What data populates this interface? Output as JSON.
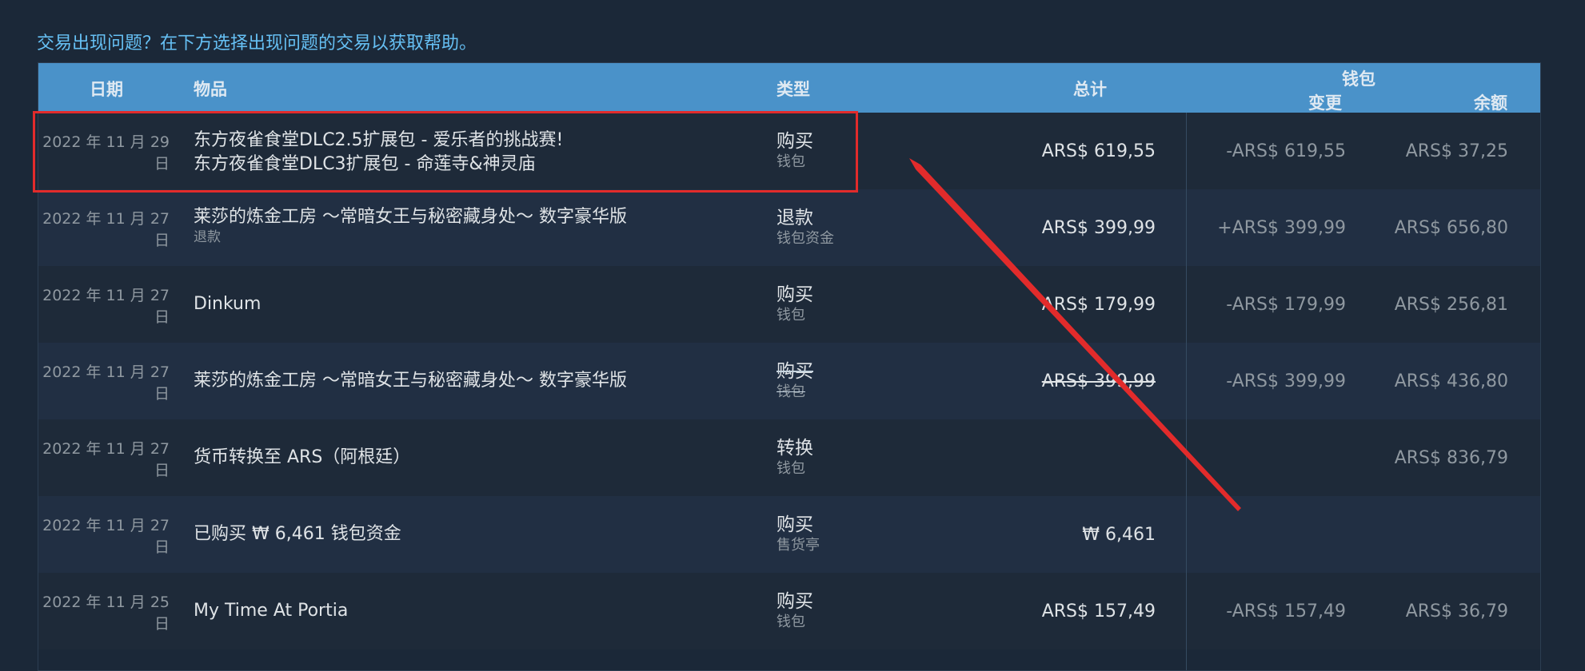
{
  "help_link": "交易出现问题？在下方选择出现问题的交易以获取帮助。",
  "headers": {
    "date": "日期",
    "items": "物品",
    "type": "类型",
    "total": "总计",
    "wallet": "钱包",
    "change": "变更",
    "balance": "余额"
  },
  "rows": [
    {
      "date_line1": "2022 年 11 月 29",
      "date_line2": "日",
      "item_line1": "东方夜雀食堂DLC2.5扩展包 - 爱乐者的挑战赛!",
      "item_line2": "东方夜雀食堂DLC3扩展包 - 命莲寺&神灵庙",
      "item_sub": "",
      "type": "购买",
      "type_sub": "钱包",
      "total": "ARS$ 619,55",
      "change": "-ARS$ 619,55",
      "balance": "ARS$ 37,25"
    },
    {
      "date_line1": "2022 年 11 月 27",
      "date_line2": "日",
      "item_line1": "莱莎的炼金工房 ～常暗女王与秘密藏身处～ 数字豪华版",
      "item_line2": "",
      "item_sub": "退款",
      "type": "退款",
      "type_sub": "钱包资金",
      "total": "ARS$ 399,99",
      "change": "+ARS$ 399,99",
      "balance": "ARS$ 656,80"
    },
    {
      "date_line1": "2022 年 11 月 27",
      "date_line2": "日",
      "item_line1": "Dinkum",
      "item_line2": "",
      "item_sub": "",
      "type": "购买",
      "type_sub": "钱包",
      "total": "ARS$ 179,99",
      "change": "-ARS$ 179,99",
      "balance": "ARS$ 256,81"
    },
    {
      "date_line1": "2022 年 11 月 27",
      "date_line2": "日",
      "item_line1": "莱莎的炼金工房 ～常暗女王与秘密藏身处～ 数字豪华版",
      "item_line2": "",
      "item_sub": "",
      "type": "购买",
      "type_sub": "钱包",
      "total": "ARS$ 399,99",
      "change": "-ARS$ 399,99",
      "balance": "ARS$ 436,80"
    },
    {
      "date_line1": "2022 年 11 月 27",
      "date_line2": "日",
      "item_line1": "货币转换至 ARS（阿根廷）",
      "item_line2": "",
      "item_sub": "",
      "type": "转换",
      "type_sub": "钱包",
      "total": "",
      "change": "",
      "balance": "ARS$ 836,79"
    },
    {
      "date_line1": "2022 年 11 月 27",
      "date_line2": "日",
      "item_line1": "已购买 ₩ 6,461 钱包资金",
      "item_line2": "",
      "item_sub": "",
      "type": "购买",
      "type_sub": "售货亭",
      "total": "₩ 6,461",
      "change": "",
      "balance": ""
    },
    {
      "date_line1": "2022 年 11 月 25",
      "date_line2": "日",
      "item_line1": "My Time At Portia",
      "item_line2": "",
      "item_sub": "",
      "type": "购买",
      "type_sub": "钱包",
      "total": "ARS$ 157,49",
      "change": "-ARS$ 157,49",
      "balance": "ARS$ 36,79"
    }
  ],
  "colors": {
    "background": "#1b2838",
    "header": "#4a92c9",
    "link": "#66c0f4",
    "annotation": "#e22b2b"
  }
}
